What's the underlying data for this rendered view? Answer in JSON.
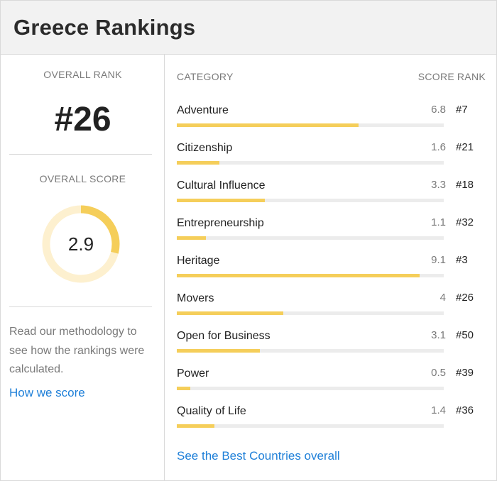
{
  "header": {
    "title": "Greece Rankings"
  },
  "overview": {
    "rank_label": "OVERALL RANK",
    "rank_value": "#26",
    "score_label": "OVERALL SCORE",
    "score_value": "2.9",
    "score_fraction": 0.29,
    "methodology_text": "Read our methodology to see how the rankings were calculated.",
    "how_link": "How we score"
  },
  "table": {
    "headers": {
      "category": "CATEGORY",
      "score": "SCORE",
      "rank": "RANK"
    },
    "rows": [
      {
        "name": "Adventure",
        "score": "6.8",
        "rank": "#7"
      },
      {
        "name": "Citizenship",
        "score": "1.6",
        "rank": "#21"
      },
      {
        "name": "Cultural Influence",
        "score": "3.3",
        "rank": "#18"
      },
      {
        "name": "Entrepreneurship",
        "score": "1.1",
        "rank": "#32"
      },
      {
        "name": "Heritage",
        "score": "9.1",
        "rank": "#3"
      },
      {
        "name": "Movers",
        "score": "4",
        "rank": "#26"
      },
      {
        "name": "Open for Business",
        "score": "3.1",
        "rank": "#50"
      },
      {
        "name": "Power",
        "score": "0.5",
        "rank": "#39"
      },
      {
        "name": "Quality of Life",
        "score": "1.4",
        "rank": "#36"
      }
    ],
    "see_all_link": "See the Best Countries overall"
  },
  "colors": {
    "accent": "#f5ce5a",
    "donut_track": "#fdf0cf",
    "link": "#1e7fd8",
    "muted": "#7a7a7a"
  }
}
